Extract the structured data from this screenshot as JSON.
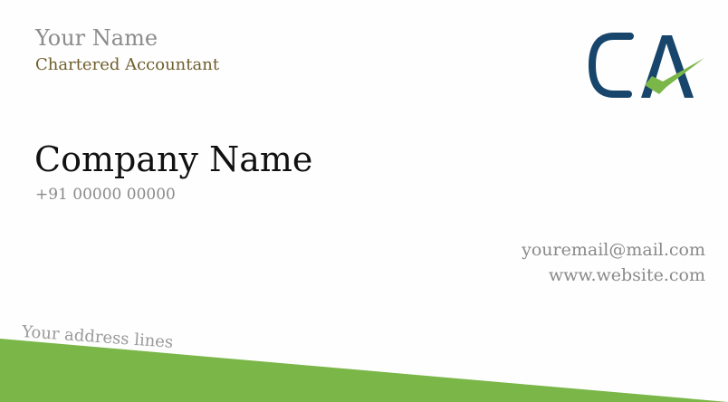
{
  "card": {
    "name": "Your Name",
    "title": "Chartered Accountant",
    "company": "Company Name",
    "phone": "+91 00000 00000",
    "email": "youremail@mail.com",
    "website": "www.website.com",
    "address": "Your address lines"
  },
  "logo": {
    "icon": "ca-logo-icon",
    "text": "CA"
  },
  "colors": {
    "accent_green": "#7ab648",
    "logo_blue": "#17456b",
    "title_brown": "#6f5e2c"
  }
}
